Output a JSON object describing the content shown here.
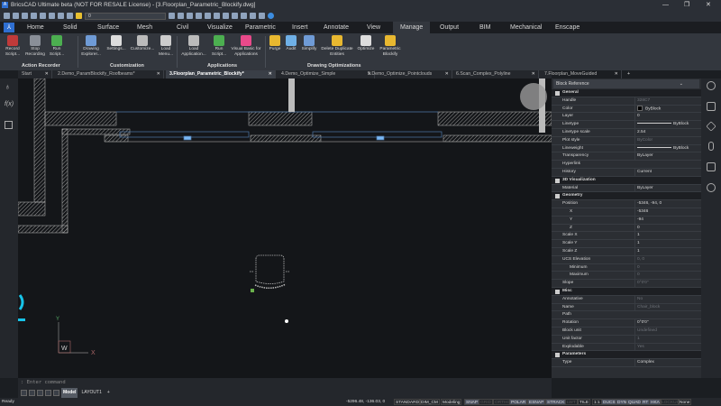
{
  "titlebar": {
    "title": "BricsCAD Ultimate beta (NOT FOR RESALE License) - [3.Floorplan_Parametric_Blockify.dwg]",
    "logo": "A",
    "minimize": "—",
    "restore": "❐",
    "close": "✕"
  },
  "qat": {
    "layer_value": "0"
  },
  "ribbon_tabs": [
    {
      "label": "Home"
    },
    {
      "label": "Solid"
    },
    {
      "label": "Surface"
    },
    {
      "label": "Mesh"
    },
    {
      "label": "Civil"
    },
    {
      "label": "Visualize"
    },
    {
      "label": "Parametric"
    },
    {
      "label": "Insert"
    },
    {
      "label": "Annotate"
    },
    {
      "label": "View"
    },
    {
      "label": "Manage",
      "active": true
    },
    {
      "label": "Output"
    },
    {
      "label": "BIM"
    },
    {
      "label": "Mechanical"
    },
    {
      "label": "Enscape"
    }
  ],
  "ribbon": {
    "buttons": [
      {
        "label": "Record Script...",
        "color": "#c03a3a"
      },
      {
        "label": "Stop Recording",
        "color": "#8a8f98"
      },
      {
        "label": "Run Script...",
        "color": "#4caf50"
      },
      {
        "label": "Drawing Explorer...",
        "color": "#6f9bd6"
      },
      {
        "label": "Settings...",
        "color": "#dddddd"
      },
      {
        "label": "Customize...",
        "color": "#bbbbbb"
      },
      {
        "label": "Load Menu...",
        "color": "#cccccc"
      },
      {
        "label": "Load Application...",
        "color": "#bbbbbb"
      },
      {
        "label": "Run Script...",
        "color": "#4caf50"
      },
      {
        "label": "Visual Basic for Applications",
        "color": "#e84a8a"
      },
      {
        "label": "Purge",
        "color": "#e8b830"
      },
      {
        "label": "Audit",
        "color": "#6fb0e6"
      },
      {
        "label": "Simplify",
        "color": "#6f9bd6"
      },
      {
        "label": "Delete Duplicate Entities",
        "color": "#e8b830"
      },
      {
        "label": "Optimize",
        "color": "#dddddd"
      },
      {
        "label": "Parametric Blockify",
        "color": "#e8b830"
      }
    ],
    "panels": [
      "Action Recorder",
      "Customization",
      "Applications",
      "Drawing Optimizations"
    ]
  },
  "doc_tabs": [
    {
      "label": "Start"
    },
    {
      "label": "2.Demo_ParamBlockify_Roofbeams*"
    },
    {
      "label": "3.Floorplan_Parametric_Blockify*",
      "active": true
    },
    {
      "label": "4.Demo_Optimize_Simple"
    },
    {
      "label": "5.Demo_Optimize_Pointclouds"
    },
    {
      "label": "6.Scan_Complex_Polyline"
    },
    {
      "label": "7.Floorplan_MoveGuided"
    }
  ],
  "doc_tab_close": "✕",
  "doc_tab_add": "+",
  "canvas": {
    "ucs_y": "Y",
    "ucs_x": "X",
    "ucs_w": "W"
  },
  "properties": {
    "selector": "Block Reference",
    "rows": [
      {
        "type": "cat",
        "key": "General"
      },
      {
        "key": "Handle",
        "value": "328C7",
        "dim": true
      },
      {
        "key": "Color",
        "value": "ByBlock",
        "swatch": true
      },
      {
        "key": "Layer",
        "value": "0"
      },
      {
        "key": "Linetype",
        "value": "ByBlock",
        "line": true
      },
      {
        "key": "Linetype scale",
        "value": "2.54"
      },
      {
        "key": "Plot style",
        "value": "ByColor",
        "dim": true
      },
      {
        "key": "Lineweight",
        "value": "ByBlock",
        "line": true
      },
      {
        "key": "Transparency",
        "value": "ByLayer"
      },
      {
        "key": "Hyperlink",
        "value": ""
      },
      {
        "key": "History",
        "value": "Current"
      },
      {
        "type": "cat",
        "key": "3D Visualization"
      },
      {
        "key": "Material",
        "value": "ByLayer"
      },
      {
        "type": "cat",
        "key": "Geometry"
      },
      {
        "key": "Position",
        "value": "-5346, -94, 0",
        "box": true
      },
      {
        "key": "X",
        "value": "-5346",
        "sub": true
      },
      {
        "key": "Y",
        "value": "-94",
        "sub": true
      },
      {
        "key": "Z",
        "value": "0",
        "sub": true
      },
      {
        "key": "Scale X",
        "value": "1"
      },
      {
        "key": "Scale Y",
        "value": "1"
      },
      {
        "key": "Scale Z",
        "value": "1"
      },
      {
        "key": "UCS Elevation",
        "value": "0, 0",
        "dim": true,
        "box": true
      },
      {
        "key": "Minimum",
        "value": "0",
        "dim": true,
        "sub": true
      },
      {
        "key": "Maximum",
        "value": "0",
        "dim": true,
        "sub": true
      },
      {
        "key": "Slope",
        "value": "0°0'0\"",
        "dim": true
      },
      {
        "type": "cat",
        "key": "Misc"
      },
      {
        "key": "Annotative",
        "value": "No",
        "dim": true
      },
      {
        "key": "Name",
        "value": "Chair_block",
        "dim": true
      },
      {
        "key": "Path",
        "value": ""
      },
      {
        "key": "Rotation",
        "value": "0°0'0\""
      },
      {
        "key": "Block unit",
        "value": "Undefined",
        "dim": true
      },
      {
        "key": "Unit factor",
        "value": "1",
        "dim": true
      },
      {
        "key": "Explodable",
        "value": "Yes",
        "dim": true
      },
      {
        "type": "cat",
        "key": "Parameters"
      },
      {
        "key": "Type",
        "value": "Complex"
      }
    ]
  },
  "command": {
    "placeholder": ": Enter command"
  },
  "layouts": {
    "tabs": [
      "Model",
      "LAYOUT1"
    ],
    "add": "+"
  },
  "status": {
    "ready": "Ready",
    "coords": "-5296.48, -136.03, 0",
    "toggles": [
      {
        "label": "STANDARD"
      },
      {
        "label": "DIM_CM"
      },
      {
        "label": "Modeling"
      },
      {
        "label": "SNAP",
        "on": true
      },
      {
        "label": "GRID",
        "off": true
      },
      {
        "label": "ORTHO",
        "off": true
      },
      {
        "label": "POLAR",
        "on": true
      },
      {
        "label": "ESNAP",
        "on": true
      },
      {
        "label": "STRACK",
        "on": true
      },
      {
        "label": "LWT",
        "off": true
      },
      {
        "label": "TILE"
      },
      {
        "label": "1:1"
      },
      {
        "label": "DUCS",
        "on": true
      },
      {
        "label": "DYN",
        "on": true
      },
      {
        "label": "QUAD",
        "on": true
      },
      {
        "label": "RT",
        "on": true
      },
      {
        "label": "HKA",
        "on": true
      },
      {
        "label": "LOCKUI",
        "off": true
      },
      {
        "label": "None"
      }
    ]
  }
}
